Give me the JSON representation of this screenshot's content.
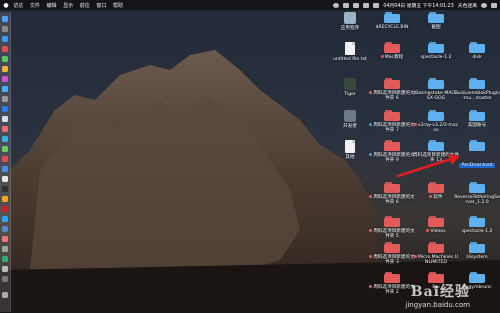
{
  "menubar": {
    "apple": "",
    "items": [
      "访达",
      "文件",
      "编辑",
      "显示",
      "前往",
      "窗口",
      "帮助"
    ],
    "status": {
      "battery": "",
      "datetime": "04月04日 星期五 下午14:01:23",
      "user": "天色迷离"
    }
  },
  "desktop_icons": [
    {
      "label": "应用程序",
      "kind": "app"
    },
    {
      "label": "$RECYCLE.BIN",
      "kind": "folder-blue"
    },
    {
      "label": "截图",
      "kind": "folder-blue"
    },
    {
      "label": "untitled file.txt",
      "kind": "doc"
    },
    {
      "label": "Mac教程",
      "kind": "folder-red"
    },
    {
      "label": "spectacle-1.2",
      "kind": "folder-blue"
    },
    {
      "label": "disk",
      "kind": "folder-blue"
    },
    {
      "label": "Tiger",
      "kind": "app"
    },
    {
      "label": "周科选项目新建的文件夹 6",
      "kind": "folder-red"
    },
    {
      "label": "iBasingstoke.MACOSX-GOG",
      "kind": "folder-blue"
    },
    {
      "label": "GuiduiemblokPlugin-mu...master",
      "kind": "folder-blue"
    },
    {
      "label": "开发者",
      "kind": "app"
    },
    {
      "label": "周科选项目新建的文件夹 7",
      "kind": "folder-red"
    },
    {
      "label": "v2ray-v3.2/2-macos",
      "kind": "folder-blue"
    },
    {
      "label": "美国账号",
      "kind": "folder-blue"
    },
    {
      "label": "其他",
      "kind": "doc"
    },
    {
      "label": "周科选项目新建的文件夹 9",
      "kind": "folder-red"
    },
    {
      "label": "周科选项目新建的文件夹 13",
      "kind": "folder-blue"
    },
    {
      "label": "PanDownload",
      "kind": "folder-blue",
      "selected": true
    },
    {
      "label": "周科选项目新建的文件夹 6",
      "kind": "folder-red"
    },
    {
      "label": "软件",
      "kind": "folder-red"
    },
    {
      "label": "ReverseTetheringServer_1.2.0",
      "kind": "folder-blue"
    },
    {
      "label": "周科选项目新建的文件夹 5",
      "kind": "folder-red"
    },
    {
      "label": "Videos",
      "kind": "folder-red"
    },
    {
      "label": "spectacle-1.2",
      "kind": "folder-blue"
    },
    {
      "label": "周科选项目新建的文件夹 3",
      "kind": "folder-red"
    },
    {
      "label": "Micro.Machines.UNLIMITED",
      "kind": "folder-red"
    },
    {
      "label": "Uisystem",
      "kind": "folder-blue"
    },
    {
      "label": "周科选项目新建的文件夹 2",
      "kind": "folder-red"
    },
    {
      "label": "Bai",
      "kind": "folder-red"
    },
    {
      "label": "Bugymbrunc",
      "kind": "folder-blue"
    }
  ],
  "watermark": {
    "brand": "Bai经验",
    "url": "jingyan.baidu.com"
  },
  "colors": {
    "selection": "#1a6be0",
    "folder_blue": "#5fb0ee",
    "folder_red": "#e45a5a",
    "arrow": "#e01e1e"
  }
}
